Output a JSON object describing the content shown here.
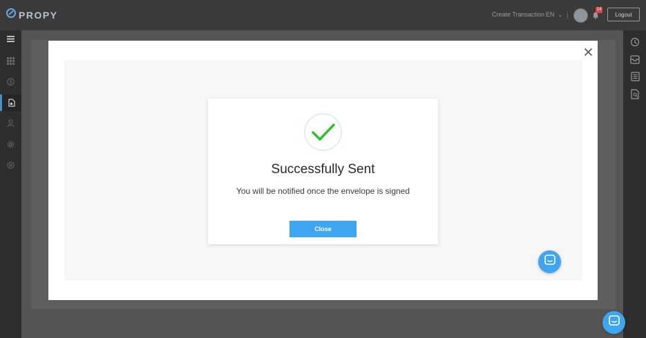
{
  "header": {
    "brand": "PROPY",
    "create_transaction": "Create Transaction",
    "language": "EN",
    "notification_count": "14",
    "logout_label": "Logout"
  },
  "left_sidebar": {
    "items": [
      {
        "icon": "menu-icon"
      },
      {
        "icon": "grid-icon"
      },
      {
        "icon": "dollar-icon"
      },
      {
        "icon": "document-icon",
        "active": true
      },
      {
        "icon": "user-icon"
      },
      {
        "icon": "gear-icon"
      },
      {
        "icon": "settings-icon"
      }
    ]
  },
  "right_sidebar": {
    "items": [
      {
        "icon": "history-icon"
      },
      {
        "icon": "inbox-icon"
      },
      {
        "icon": "list-icon"
      },
      {
        "icon": "file-search-icon"
      }
    ]
  },
  "dialog": {
    "title": "Successfully Sent",
    "message": "You will be notified once the envelope is signed",
    "close_label": "Close"
  },
  "colors": {
    "accent": "#3ea5ee",
    "success": "#2fbf2f",
    "badge": "#d84a4a"
  }
}
